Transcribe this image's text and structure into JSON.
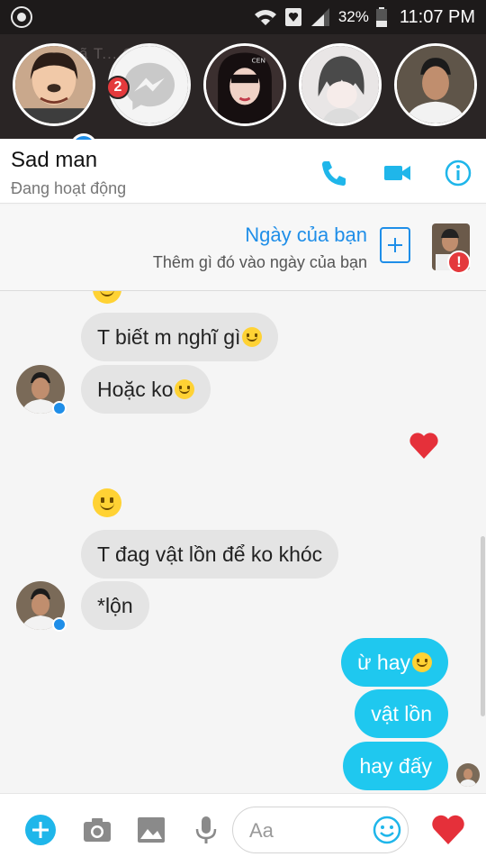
{
  "status_bar": {
    "battery_percent": "32%",
    "time": "11:07 PM",
    "icons": [
      "app-icon",
      "wifi-icon",
      "heart-shield-icon",
      "signal-icon",
      "battery-icon"
    ]
  },
  "chat_heads": {
    "ghost_text": "ã T... Giá",
    "badge_count": "2",
    "heads": [
      "girl-avatar",
      "messenger-icon",
      "girl-avatar-2",
      "anime-avatar",
      "sad-man-avatar"
    ],
    "head3_label": "CEN"
  },
  "conversation": {
    "name": "Sad man",
    "status": "Đang hoạt động"
  },
  "day_card": {
    "title": "Ngày của bạn",
    "subtitle": "Thêm gì đó vào ngày của bạn",
    "alert": "!"
  },
  "messages": [
    {
      "text": "T biết m nghĩ gì",
      "emoji": true,
      "side": "in"
    },
    {
      "text": "Hoặc ko",
      "emoji": true,
      "side": "in"
    },
    {
      "text": "T đag vật lồn để ko khóc",
      "emoji": false,
      "side": "in"
    },
    {
      "text": "*lộn",
      "emoji": false,
      "side": "in"
    },
    {
      "text": "ừ hay ",
      "emoji": true,
      "side": "out"
    },
    {
      "text": "vật lồn",
      "emoji": false,
      "side": "out"
    },
    {
      "text": "hay đấy",
      "emoji": false,
      "side": "out"
    }
  ],
  "composer": {
    "placeholder": "Aa",
    "icons": [
      "plus-icon",
      "camera-icon",
      "image-icon",
      "mic-icon",
      "emoji-icon",
      "heart-icon"
    ]
  },
  "colors": {
    "accent": "#1f8ee8",
    "outgoing_bubble": "#1fc8ef",
    "incoming_bubble": "#e4e4e4",
    "heart": "#e5303a",
    "badge": "#e4393c"
  }
}
